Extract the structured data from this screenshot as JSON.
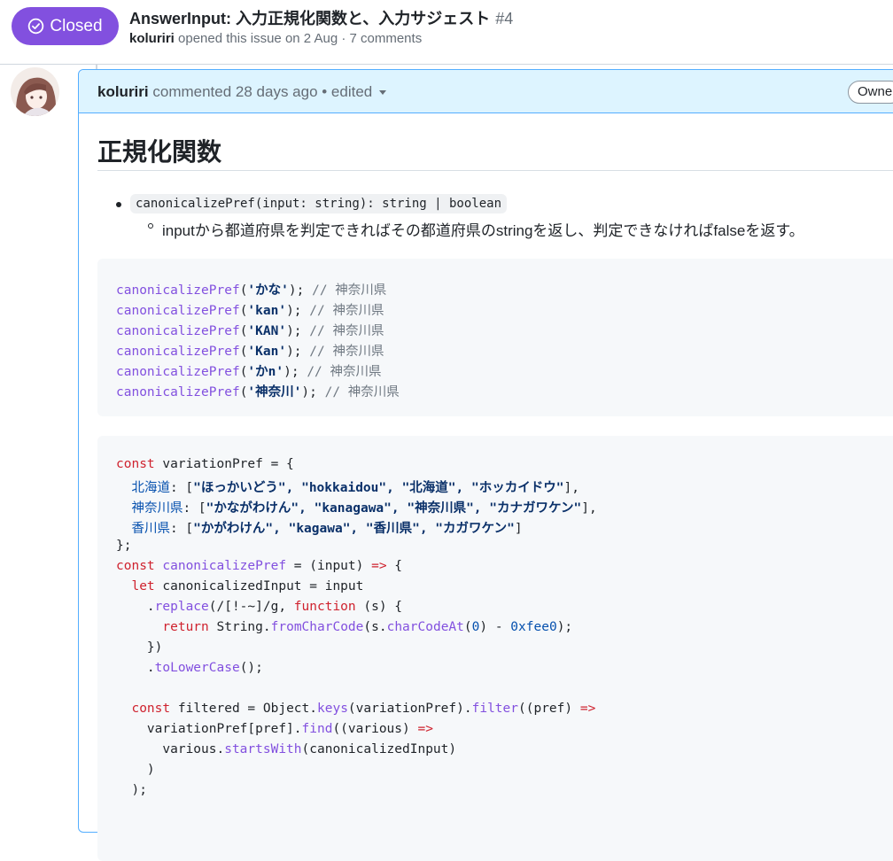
{
  "issue": {
    "state_label": "Closed",
    "title": "AnswerInput: 入力正規化関数と、入力サジェスト",
    "number": "#4",
    "author": "koluriri",
    "meta_text": "opened this issue on 2 Aug · 7 comments"
  },
  "comment": {
    "author": "koluriri",
    "meta": "commented 28 days ago • edited",
    "role_badge": "Owne",
    "heading": "正規化関数",
    "signature": "canonicalizePref(input: string): string | boolean",
    "description": "inputから都道府県を判定できればその都道府県のstringを返し、判定できなければfalseを返す。"
  },
  "code1": [
    {
      "fn": "canonicalizePref",
      "open": "(",
      "arg": "'かな'",
      "close": ");",
      "comment": " // 神奈川県"
    },
    {
      "fn": "canonicalizePref",
      "open": "(",
      "arg": "'kan'",
      "close": ");",
      "comment": " // 神奈川県"
    },
    {
      "fn": "canonicalizePref",
      "open": "(",
      "arg": "'KAN'",
      "close": ");",
      "comment": " // 神奈川県"
    },
    {
      "fn": "canonicalizePref",
      "open": "(",
      "arg": "'Kan'",
      "close": ");",
      "comment": " // 神奈川県"
    },
    {
      "fn": "canonicalizePref",
      "open": "(",
      "arg": "'かn'",
      "close": ");",
      "comment": " // 神奈川県"
    },
    {
      "fn": "canonicalizePref",
      "open": "(",
      "arg": "'神奈川'",
      "close": ");",
      "comment": " // 神奈川県"
    }
  ],
  "code2": {
    "l1": {
      "kw": "const",
      "rest": " variationPref = {"
    },
    "l2": {
      "indent": "  ",
      "key": "北海道",
      "rest": ": [",
      "vals": "\"ほっかいどう\", \"hokkaidou\", \"北海道\", \"ホッカイドウ\"",
      "end": "],"
    },
    "l3": {
      "indent": "  ",
      "key": "神奈川県",
      "rest": ": [",
      "vals": "\"かながわけん\", \"kanagawa\", \"神奈川県\", \"カナガワケン\"",
      "end": "],"
    },
    "l4": {
      "indent": "  ",
      "key": "香川県",
      "rest": ": [",
      "vals": "\"かがわけん\", \"kagawa\", \"香川県\", \"カガワケン\"",
      "end": "]"
    },
    "l5": "};",
    "l6": {
      "kw": "const",
      "name": " canonicalizePref",
      "rest": " = (input) ",
      "arrow": "=>",
      "end": " {"
    },
    "l7": {
      "indent": "  ",
      "kw": "let",
      "rest": " canonicalizedInput = input"
    },
    "l8": {
      "indent": "    .",
      "fn": "replace",
      "p1": "(/[!-~]/g, ",
      "kw": "function",
      "rest": " (s) {"
    },
    "l9": {
      "indent": "      ",
      "kw": "return",
      "p1": " String.",
      "fn": "fromCharCode",
      "p2": "(s.",
      "fn2": "charCodeAt",
      "p3": "(",
      "num": "0",
      "p4": ") - ",
      "hex": "0xfee0",
      "end": ");"
    },
    "l10": "    })",
    "l11": {
      "indent": "    .",
      "fn": "toLowerCase",
      "rest": "();"
    },
    "l12": {
      "indent": "  ",
      "kw": "const",
      "p1": " filtered = Object.",
      "fn": "keys",
      "p2": "(variationPref).",
      "fn2": "filter",
      "p3": "((pref) ",
      "arrow": "=>"
    },
    "l13": {
      "indent": "    variationPref[pref].",
      "fn": "find",
      "p1": "((various) ",
      "arrow": "=>"
    },
    "l14": {
      "indent": "      various.",
      "fn": "startsWith",
      "rest": "(canonicalizedInput)"
    },
    "l15": "    )",
    "l16": "  );"
  }
}
